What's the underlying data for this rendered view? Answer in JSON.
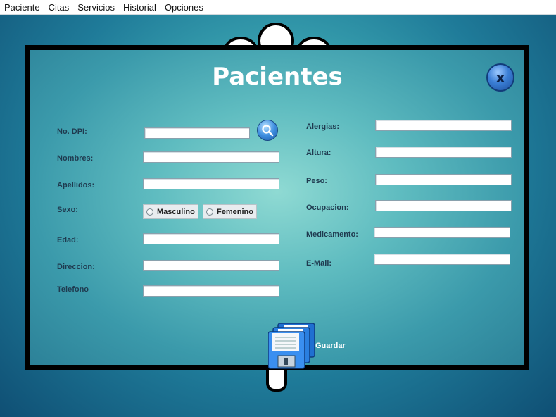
{
  "menu": {
    "items": [
      {
        "label": "Paciente"
      },
      {
        "label": "Citas"
      },
      {
        "label": "Servicios"
      },
      {
        "label": "Historial"
      },
      {
        "label": "Opciones"
      }
    ]
  },
  "form": {
    "title": "Pacientes",
    "close_label": "x",
    "left": {
      "dpi_label": "No. DPI:",
      "nombres_label": "Nombres:",
      "apellidos_label": "Apellidos:",
      "sexo_label": "Sexo:",
      "edad_label": "Edad:",
      "direccion_label": "Direccion:",
      "telefono_label": "Telefono"
    },
    "sexo_options": [
      "Masculino",
      "Femenino"
    ],
    "right": {
      "alergias_label": "Alergias:",
      "altura_label": "Altura:",
      "peso_label": "Peso:",
      "ocupacion_label": "Ocupacion:",
      "medicamento_label": "Medicamento:",
      "email_label": "E-Mail:"
    },
    "save_label": "Guardar"
  }
}
